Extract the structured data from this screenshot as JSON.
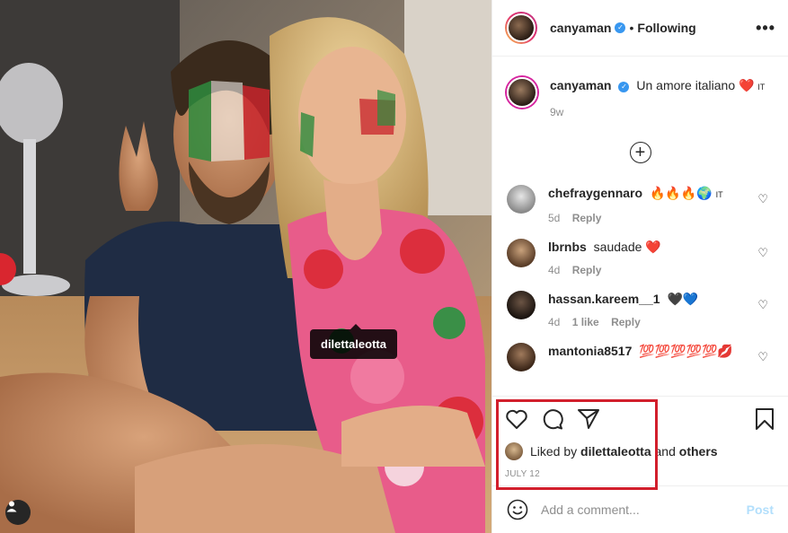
{
  "post": {
    "photo_tag": "dilettaleotta",
    "author": "canyaman",
    "follow_status": "Following",
    "caption": {
      "username": "canyaman",
      "text": "Un amore italiano ❤️",
      "flag": "IT",
      "age": "9w"
    },
    "comments": [
      {
        "username": "chefraygennaro",
        "text": "🔥🔥🔥🌍",
        "flag": "IT",
        "age": "5d",
        "likes": "",
        "reply": "Reply"
      },
      {
        "username": "lbrnbs",
        "text": "saudade ❤️",
        "flag": "",
        "age": "4d",
        "likes": "",
        "reply": "Reply"
      },
      {
        "username": "hassan.kareem__1",
        "text": "🖤💙",
        "flag": "",
        "age": "4d",
        "likes": "1 like",
        "reply": "Reply"
      },
      {
        "username": "mantonia8517",
        "text": "💯💯💯💯💯💋",
        "flag": "",
        "age": "",
        "likes": "",
        "reply": ""
      }
    ],
    "liked_by": {
      "prefix": "Liked by",
      "user": "dilettaleotta",
      "connector": "and",
      "others": "others"
    },
    "date": "JULY 12",
    "add_comment": {
      "placeholder": "Add a comment...",
      "post_label": "Post"
    }
  },
  "colors": {
    "accent": "#3897f0",
    "highlight_box": "#d21f2c",
    "post_disabled": "#b2dffc"
  },
  "icons": [
    "verified-icon",
    "more-icon",
    "load-more-icon",
    "heart-icon",
    "comment-icon",
    "share-icon",
    "save-icon",
    "emoji-icon",
    "user-tag-icon"
  ]
}
